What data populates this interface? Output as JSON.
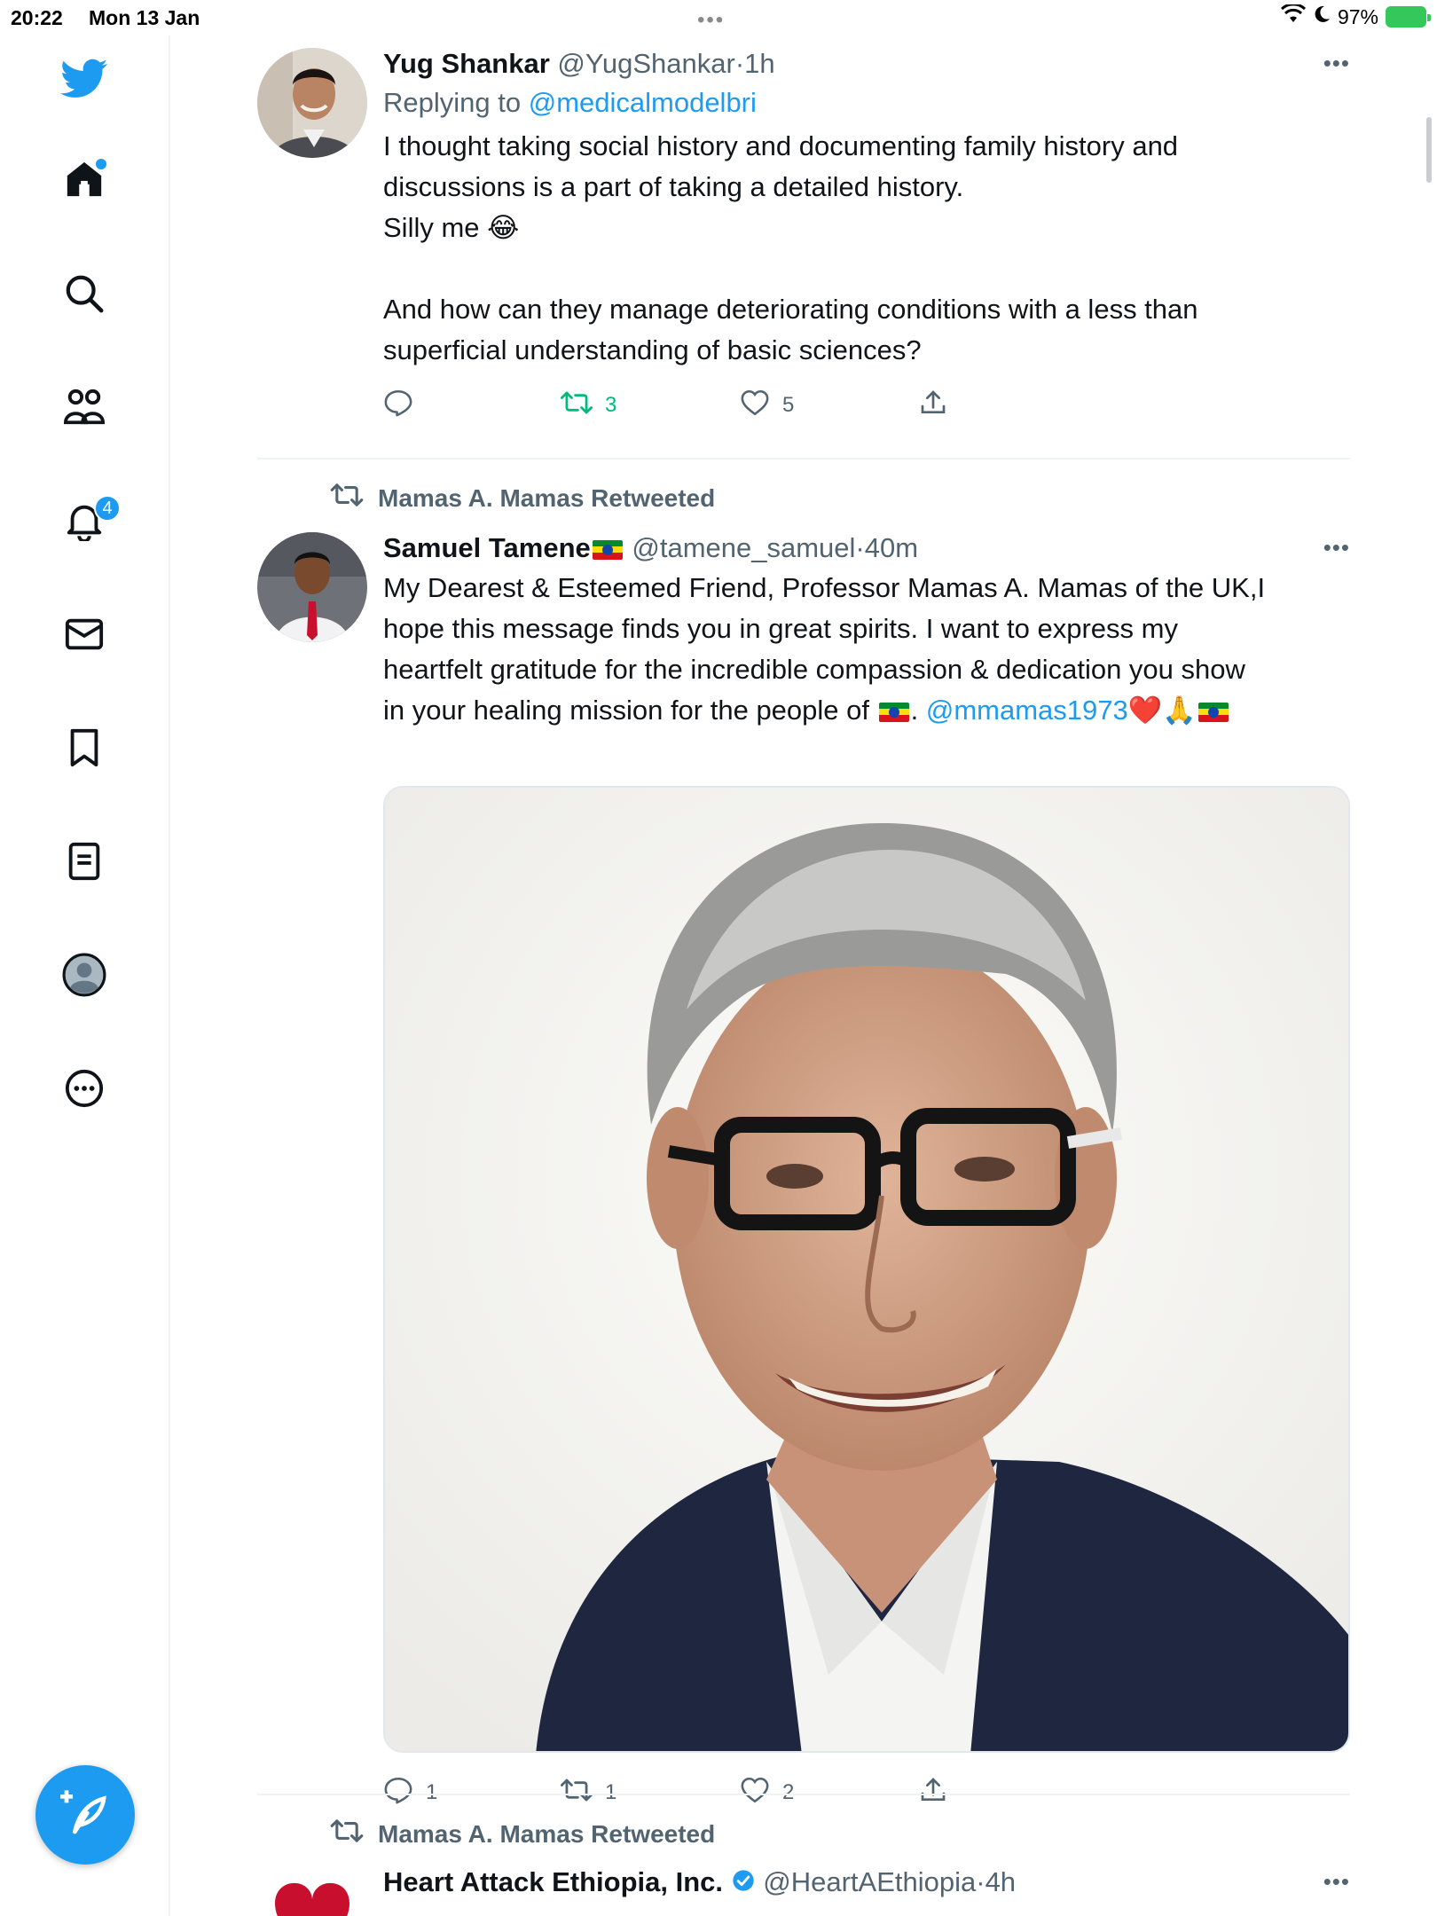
{
  "status_bar": {
    "time": "20:22",
    "date": "Mon 13 Jan",
    "dots": "•••",
    "battery": "97%"
  },
  "sidebar": {
    "items": [
      {
        "icon": "twitter-bird-icon"
      },
      {
        "icon": "home-icon"
      },
      {
        "icon": "search-icon"
      },
      {
        "icon": "communities-icon"
      },
      {
        "icon": "notifications-bell-icon",
        "badge": "4"
      },
      {
        "icon": "messages-envelope-icon"
      },
      {
        "icon": "bookmark-icon"
      },
      {
        "icon": "lists-icon"
      },
      {
        "icon": "profile-avatar-icon"
      },
      {
        "icon": "more-circle-icon"
      }
    ],
    "compose_icon": "compose-feather-icon"
  },
  "colors": {
    "accent": "#1d9bf0",
    "retweet_active": "#00ba7c",
    "muted": "#536471",
    "text": "#0f1419"
  },
  "tweet1": {
    "name": "Yug Shankar",
    "handle": "@YugShankar",
    "sep": "·",
    "time": "1h",
    "more": "•••",
    "replying_prefix": "Replying to ",
    "replying_handle": "@medicalmodelbri",
    "line1": "I thought taking social history and documenting family history and",
    "line2": "discussions is a part of taking a detailed history.",
    "line3": "Silly me 😂",
    "line4": "And how can they manage deteriorating conditions with a less than",
    "line5": "superficial understanding of basic sciences?",
    "reply_count": "",
    "retweet_count": "3",
    "like_count": "5"
  },
  "tweet2": {
    "retweeted_by": "Mamas A. Mamas Retweeted",
    "name": "Samuel Tamene",
    "handle": "@tamene_samuel",
    "sep": "·",
    "time": "40m",
    "more": "•••",
    "line1": "My Dearest & Esteemed Friend, Professor Mamas A. Mamas of the UK,I",
    "line2": "hope this message finds you in great spirits. I want to express my",
    "line3": "heartfelt gratitude for the incredible compassion & dedication you show",
    "line4_start": "in your healing mission for the people of ",
    "line4_dot": ". ",
    "mention": "@mmamas1973",
    "emojis": "❤️🙏",
    "reply_count": "1",
    "retweet_count": "1",
    "like_count": "2"
  },
  "tweet3": {
    "retweeted_by": "Mamas A. Mamas Retweeted",
    "name": "Heart Attack Ethiopia, Inc.",
    "handle": "@HeartAEthiopia",
    "sep": "·",
    "time": "4h",
    "more": "•••"
  }
}
